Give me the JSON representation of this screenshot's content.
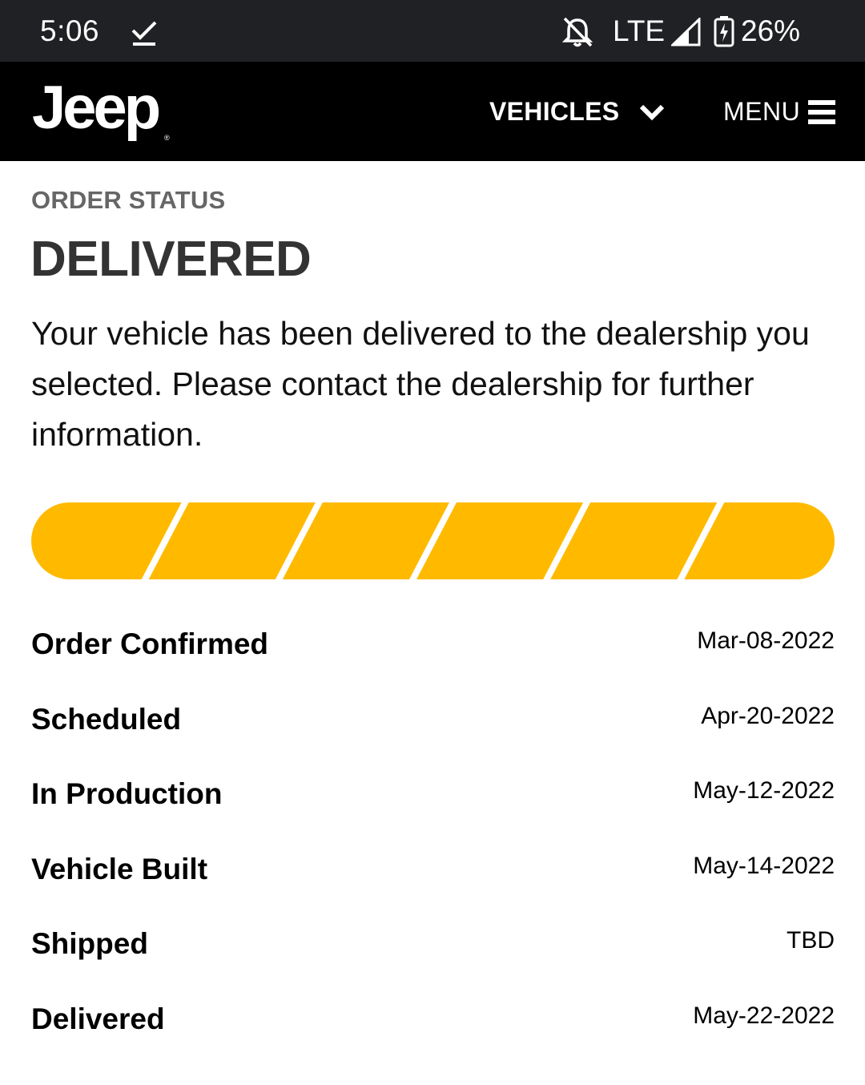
{
  "status_bar": {
    "time": "5:06",
    "network": "LTE",
    "battery": "26%",
    "icons": [
      "checkmark-icon",
      "bell-off-icon",
      "signal-icon",
      "battery-charging-icon"
    ]
  },
  "header": {
    "logo": "Jeep",
    "logo_mark": "®",
    "nav_vehicles": "VEHICLES",
    "nav_menu": "MENU"
  },
  "order": {
    "eyebrow": "ORDER STATUS",
    "status": "DELIVERED",
    "description": "Your vehicle has been delivered to the dealership you selected. Please contact the dealership for further information.",
    "progress": {
      "segments_total": 6,
      "segments_complete": 6,
      "fill_color": "#FFBA00"
    },
    "milestones": [
      {
        "label": "Order Confirmed",
        "date": "Mar-08-2022"
      },
      {
        "label": "Scheduled",
        "date": "Apr-20-2022"
      },
      {
        "label": "In Production",
        "date": "May-12-2022"
      },
      {
        "label": "Vehicle Built",
        "date": "May-14-2022"
      },
      {
        "label": "Shipped",
        "date": "TBD"
      },
      {
        "label": "Delivered",
        "date": "May-22-2022"
      }
    ]
  },
  "colors": {
    "status_bar_bg": "#202124",
    "header_bg": "#000000",
    "accent": "#FFBA00",
    "eyebrow": "#666666",
    "title": "#333333"
  }
}
